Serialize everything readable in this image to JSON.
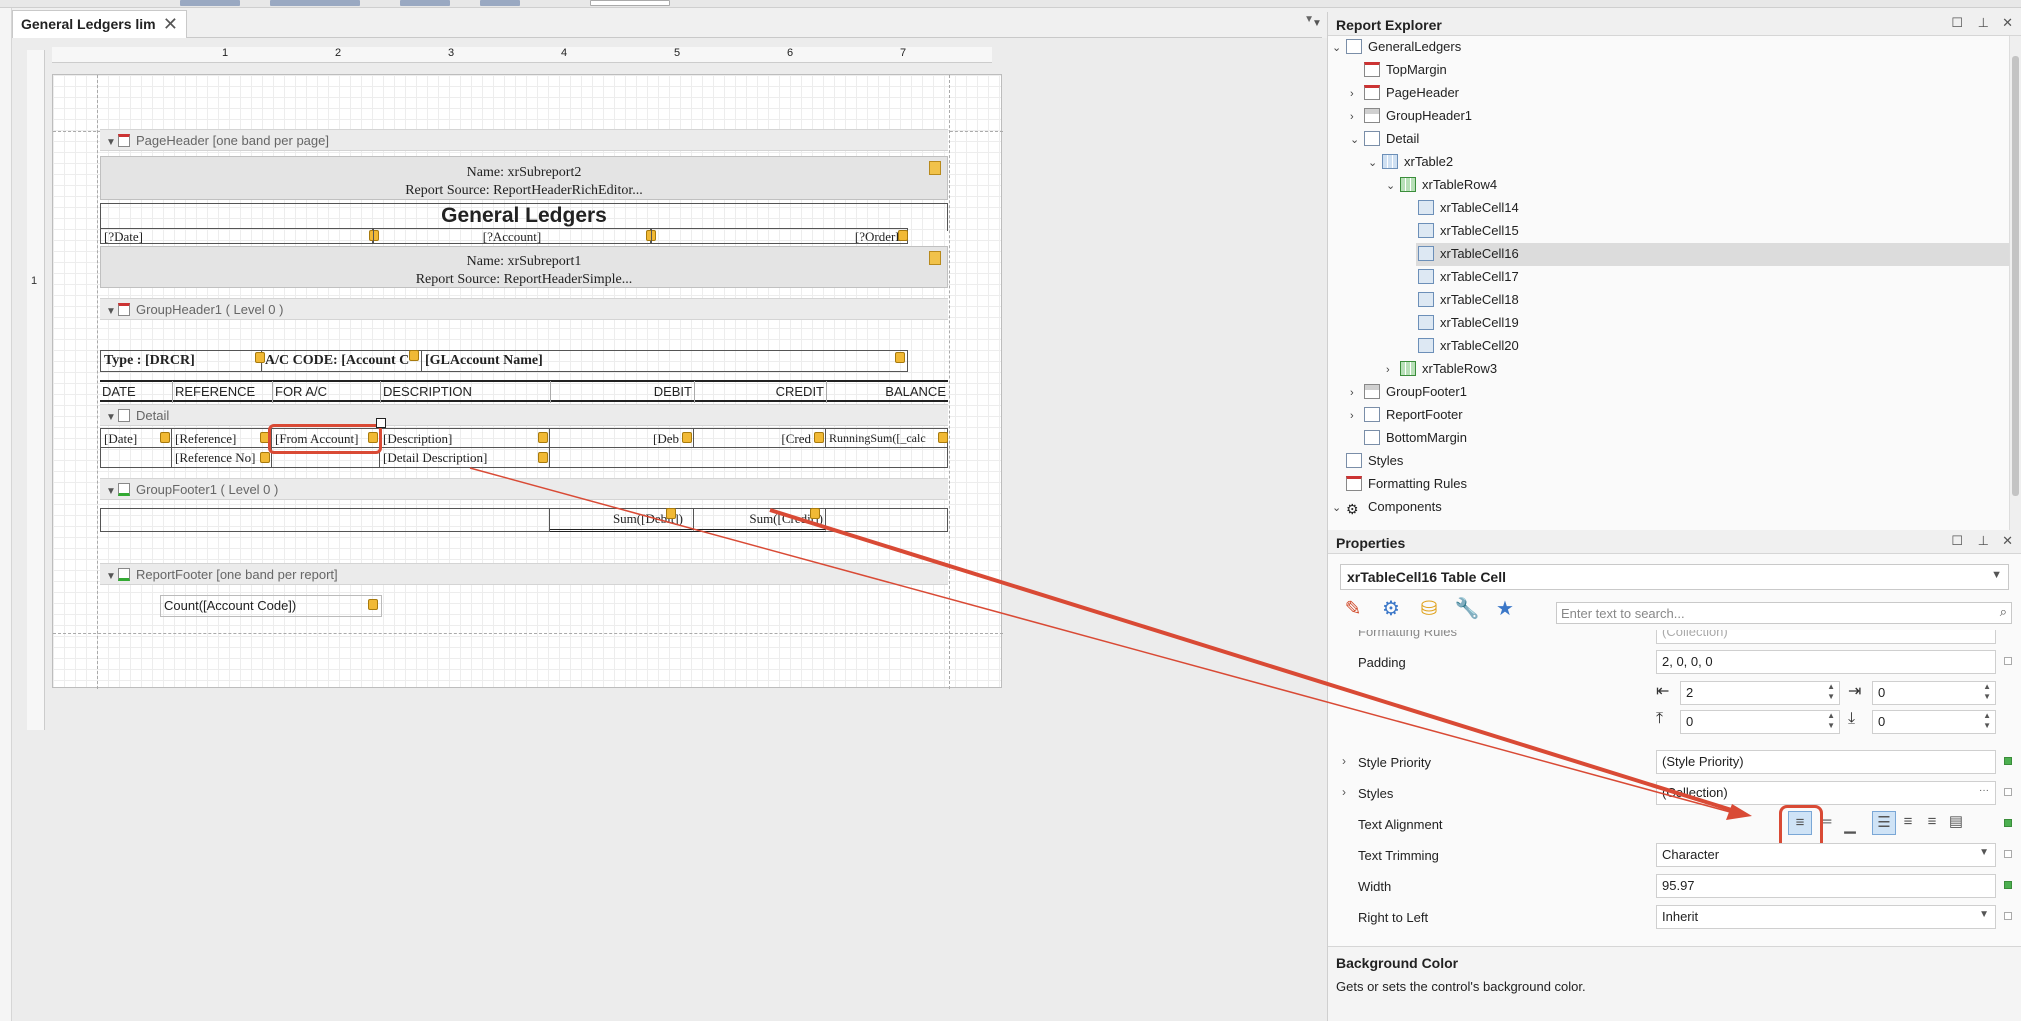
{
  "document_tab": {
    "title": "General Ledgers lim",
    "close": "✕"
  },
  "ruler": {
    "numbers": [
      "1",
      "2",
      "3",
      "4",
      "5",
      "6",
      "7"
    ],
    "vertical_number": "1"
  },
  "designer": {
    "bands": {
      "page_header": "PageHeader [one band per page]",
      "group_header": "GroupHeader1 ( Level 0 )",
      "detail": "Detail",
      "group_footer": "GroupFooter1 ( Level 0 )",
      "report_footer": "ReportFooter [one band per report]"
    },
    "subreport2": {
      "name": "Name: xrSubreport2",
      "source": "Report Source: ReportHeaderRichEditor..."
    },
    "title": "General Ledgers",
    "params": {
      "date": "[?Date]",
      "account": "[?Account]",
      "order": "[?OrderB"
    },
    "subreport1": {
      "name": "Name: xrSubreport1",
      "source": "Report Source: ReportHeaderSimple..."
    },
    "group": {
      "type": "Type : [DRCR]",
      "ac_code": "A/C CODE: [Account C",
      "gl_name": "[GLAccount Name]"
    },
    "columns": [
      "DATE",
      "REFERENCE",
      "FOR A/C",
      "DESCRIPTION",
      "DEBIT",
      "CREDIT",
      "BALANCE"
    ],
    "detail_row1": [
      "[Date]",
      "[Reference]",
      "[From Account]",
      "[Description]",
      "[Deb",
      "[Cred",
      "RunningSum([_calc"
    ],
    "detail_row2": [
      "[Reference No]",
      "[Detail Description]"
    ],
    "footer": {
      "sum_debit": "Sum([Debit])",
      "sum_credit": "Sum([Credit])"
    },
    "report_footer_count": "Count([Account Code])"
  },
  "report_explorer": {
    "title": "Report Explorer",
    "items": [
      {
        "label": "GeneralLedgers",
        "icon": "report-icon"
      },
      {
        "label": "TopMargin",
        "icon": "band-icon"
      },
      {
        "label": "PageHeader",
        "icon": "band-icon"
      },
      {
        "label": "GroupHeader1",
        "icon": "band-icon"
      },
      {
        "label": "Detail",
        "icon": "band-icon"
      },
      {
        "label": "xrTable2",
        "icon": "table-icon"
      },
      {
        "label": "xrTableRow4",
        "icon": "table-row-icon"
      },
      {
        "label": "xrTableCell14",
        "icon": "table-cell-icon"
      },
      {
        "label": "xrTableCell15",
        "icon": "table-cell-icon"
      },
      {
        "label": "xrTableCell16",
        "icon": "table-cell-icon"
      },
      {
        "label": "xrTableCell17",
        "icon": "table-cell-icon"
      },
      {
        "label": "xrTableCell18",
        "icon": "table-cell-icon"
      },
      {
        "label": "xrTableCell19",
        "icon": "table-cell-icon"
      },
      {
        "label": "xrTableCell20",
        "icon": "table-cell-icon"
      },
      {
        "label": "xrTableRow3",
        "icon": "table-row-icon"
      },
      {
        "label": "GroupFooter1",
        "icon": "band-icon"
      },
      {
        "label": "ReportFooter",
        "icon": "band-icon"
      },
      {
        "label": "BottomMargin",
        "icon": "band-icon"
      },
      {
        "label": "Styles",
        "icon": "styles-icon"
      },
      {
        "label": "Formatting Rules",
        "icon": "formatting-rules-icon"
      },
      {
        "label": "Components",
        "icon": "gear-icon"
      }
    ]
  },
  "properties": {
    "title": "Properties",
    "selected_object": "xrTableCell16   Table Cell",
    "search_placeholder": "Enter text to search...",
    "cut_row": {
      "label": "Formatting Rules",
      "value": "(Collection)"
    },
    "padding": {
      "label": "Padding",
      "value": "2, 0, 0, 0",
      "left": "2",
      "right": "0",
      "top": "0",
      "bottom": "0"
    },
    "style_priority": {
      "label": "Style Priority",
      "value": "(Style Priority)"
    },
    "styles": {
      "label": "Styles",
      "value": "(Collection)"
    },
    "text_alignment": {
      "label": "Text Alignment"
    },
    "text_trimming": {
      "label": "Text Trimming",
      "value": "Character"
    },
    "width": {
      "label": "Width",
      "value": "95.97"
    },
    "right_to_left": {
      "label": "Right to Left",
      "value": "Inherit"
    },
    "description": {
      "title": "Background Color",
      "text": "Gets or sets the control's background color."
    }
  },
  "colors": {
    "annotation": "#d94a35",
    "selection": "#dcdcdc",
    "accent": "#4caf50"
  }
}
